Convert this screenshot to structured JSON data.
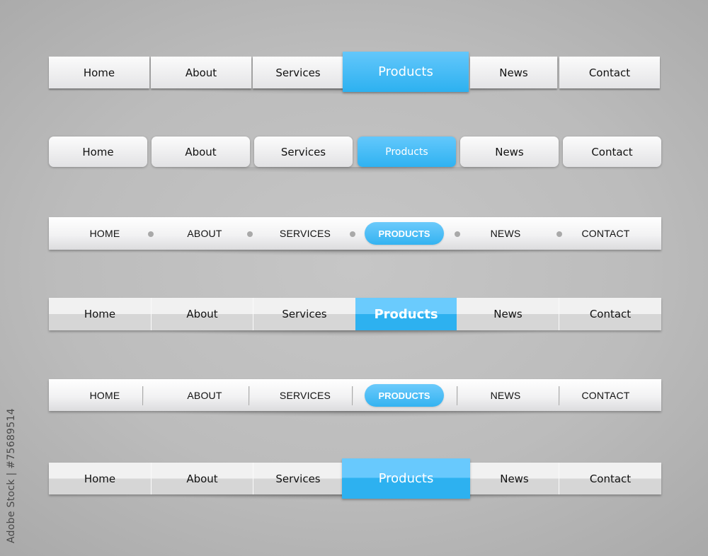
{
  "colors": {
    "accent": "#2db1f0",
    "accent_light": "#63c7fb",
    "background": "#bcbcbc",
    "button_light": "#fbfbfb",
    "button_dark": "#e4e4e6",
    "separator_dot": "#a9a9a9",
    "text": "#111111",
    "active_text": "#ffffff"
  },
  "navbars": [
    {
      "style": "separate-buttons",
      "items": [
        {
          "label": "Home"
        },
        {
          "label": "About"
        },
        {
          "label": "Services"
        },
        {
          "label": "Products",
          "active": true
        },
        {
          "label": "News"
        },
        {
          "label": "Contact"
        }
      ]
    },
    {
      "style": "rounded-buttons",
      "items": [
        {
          "label": "Home"
        },
        {
          "label": "About"
        },
        {
          "label": "Services"
        },
        {
          "label": "Products",
          "active": true
        },
        {
          "label": "News"
        },
        {
          "label": "Contact"
        }
      ]
    },
    {
      "style": "bar-dot-separators-pill",
      "items": [
        {
          "label": "HOME"
        },
        {
          "label": "ABOUT"
        },
        {
          "label": "SERVICES"
        },
        {
          "label": "PRODUCTS",
          "active": true
        },
        {
          "label": "NEWS"
        },
        {
          "label": "CONTACT"
        }
      ]
    },
    {
      "style": "glossy-split-bar",
      "items": [
        {
          "label": "Home"
        },
        {
          "label": "About"
        },
        {
          "label": "Services"
        },
        {
          "label": "Products",
          "active": true
        },
        {
          "label": "News"
        },
        {
          "label": "Contact"
        }
      ]
    },
    {
      "style": "bar-line-separators-pill",
      "items": [
        {
          "label": "HOME"
        },
        {
          "label": "ABOUT"
        },
        {
          "label": "SERVICES"
        },
        {
          "label": "PRODUCTS",
          "active": true
        },
        {
          "label": "NEWS"
        },
        {
          "label": "CONTACT"
        }
      ]
    },
    {
      "style": "glossy-split-bar-raised",
      "items": [
        {
          "label": "Home"
        },
        {
          "label": "About"
        },
        {
          "label": "Services"
        },
        {
          "label": "Products",
          "active": true
        },
        {
          "label": "News"
        },
        {
          "label": "Contact"
        }
      ]
    }
  ],
  "watermark": "Adobe Stock | #75689514"
}
